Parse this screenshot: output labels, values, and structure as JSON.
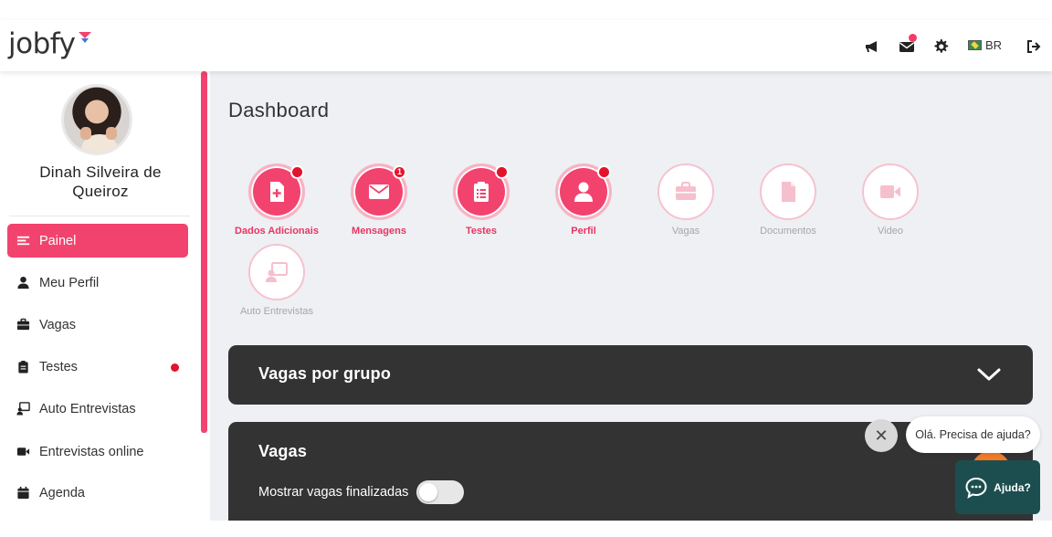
{
  "header": {
    "logo_text": "jobfy",
    "language": "BR",
    "icons": [
      "megaphone-icon",
      "mail-icon",
      "gear-icon",
      "flag-icon",
      "logout-icon"
    ]
  },
  "sidebar": {
    "user_name": "Dinah Silveira de Queiroz",
    "items": [
      {
        "label": "Painel",
        "icon": "menu-icon",
        "active": true
      },
      {
        "label": "Meu Perfil",
        "icon": "user-icon"
      },
      {
        "label": "Vagas",
        "icon": "briefcase-icon"
      },
      {
        "label": "Testes",
        "icon": "clipboard-icon",
        "has_dot": true
      },
      {
        "label": "Auto Entrevistas",
        "icon": "presentation-icon"
      },
      {
        "label": "Entrevistas online",
        "icon": "video-icon"
      },
      {
        "label": "Agenda",
        "icon": "calendar-icon"
      }
    ]
  },
  "main": {
    "title": "Dashboard",
    "cards": [
      {
        "label": "Dados Adicionais",
        "icon": "file-plus-icon",
        "active": true,
        "badge": ""
      },
      {
        "label": "Mensagens",
        "icon": "envelope-icon",
        "active": true,
        "badge": "1"
      },
      {
        "label": "Testes",
        "icon": "clipboard-list-icon",
        "active": true,
        "badge": ""
      },
      {
        "label": "Perfil",
        "icon": "user-icon",
        "active": true,
        "badge": ""
      },
      {
        "label": "Vagas",
        "icon": "briefcase-icon",
        "active": false
      },
      {
        "label": "Documentos",
        "icon": "document-icon",
        "active": false
      },
      {
        "label": "Video",
        "icon": "video-icon",
        "active": false
      },
      {
        "label": "Auto Entrevistas",
        "icon": "presentation-icon",
        "active": false
      }
    ],
    "panel_groups": {
      "title": "Vagas por grupo"
    },
    "panel_jobs": {
      "title": "Vagas",
      "toggle_label": "Mostrar vagas finalizadas",
      "toggle_on": false
    }
  },
  "help": {
    "bubble_text": "Olá. Precisa de ajuda?",
    "button_label": "Ajuda?",
    "close_symbol": "✕"
  },
  "colors": {
    "accent": "#f2436e",
    "panel": "#333333",
    "help_button": "#1d4e4f",
    "badge": "#e3132c"
  }
}
